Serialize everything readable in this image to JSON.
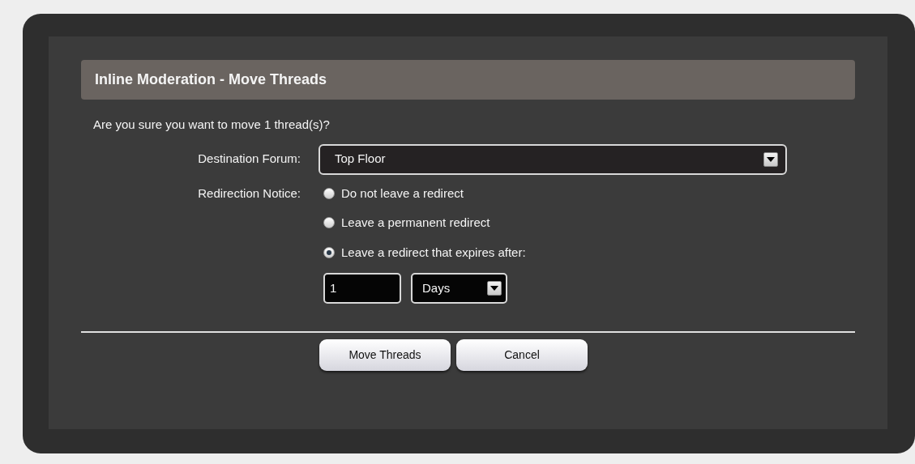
{
  "dialog": {
    "title": "Inline Moderation - Move Threads",
    "question": "Are you sure you want to move 1 thread(s)?",
    "destination": {
      "label": "Destination Forum:",
      "value": "Top Floor"
    },
    "redirect": {
      "label": "Redirection Notice:",
      "options": [
        {
          "label": "Do not leave a redirect",
          "selected": false
        },
        {
          "label": "Leave a permanent redirect",
          "selected": false
        },
        {
          "label": "Leave a redirect that expires after:",
          "selected": true
        }
      ],
      "expiry": {
        "value": "1",
        "unit": "Days"
      }
    },
    "buttons": [
      {
        "label": "Move Threads"
      },
      {
        "label": "Cancel"
      }
    ]
  }
}
